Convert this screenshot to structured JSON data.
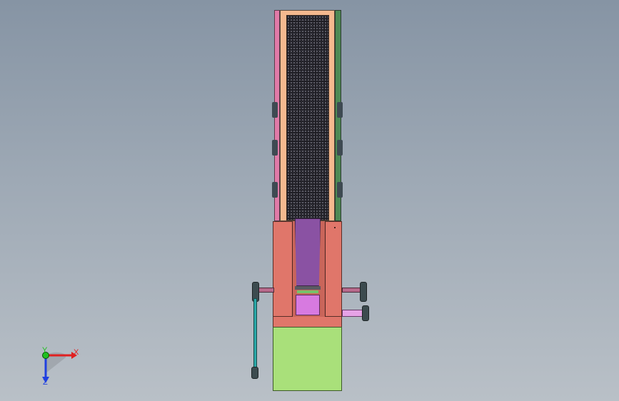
{
  "viewport": {
    "background_top": "#8694a4",
    "background_bottom": "#b9c0c7"
  },
  "model": {
    "column_outer_color": "#f4b98f",
    "column_mesh_color": "#1d1c22",
    "left_rail_color": "#e07aa8",
    "right_rail_color": "#4e8a55",
    "housing_color": "#e0766a",
    "slot_insert_color": "#8a52a3",
    "lower_insert_color": "#d77ae0",
    "base_block_color": "#a9e07a",
    "shaft_color": "#c77ab0",
    "belt_color": "#2aa8a8",
    "pulley_color": "#3c4b4f"
  },
  "triad": {
    "x_label": "X",
    "y_label": "Y",
    "z_label": "Z",
    "x_color": "#e02020",
    "y_color": "#20c020",
    "z_color": "#2040e0"
  }
}
